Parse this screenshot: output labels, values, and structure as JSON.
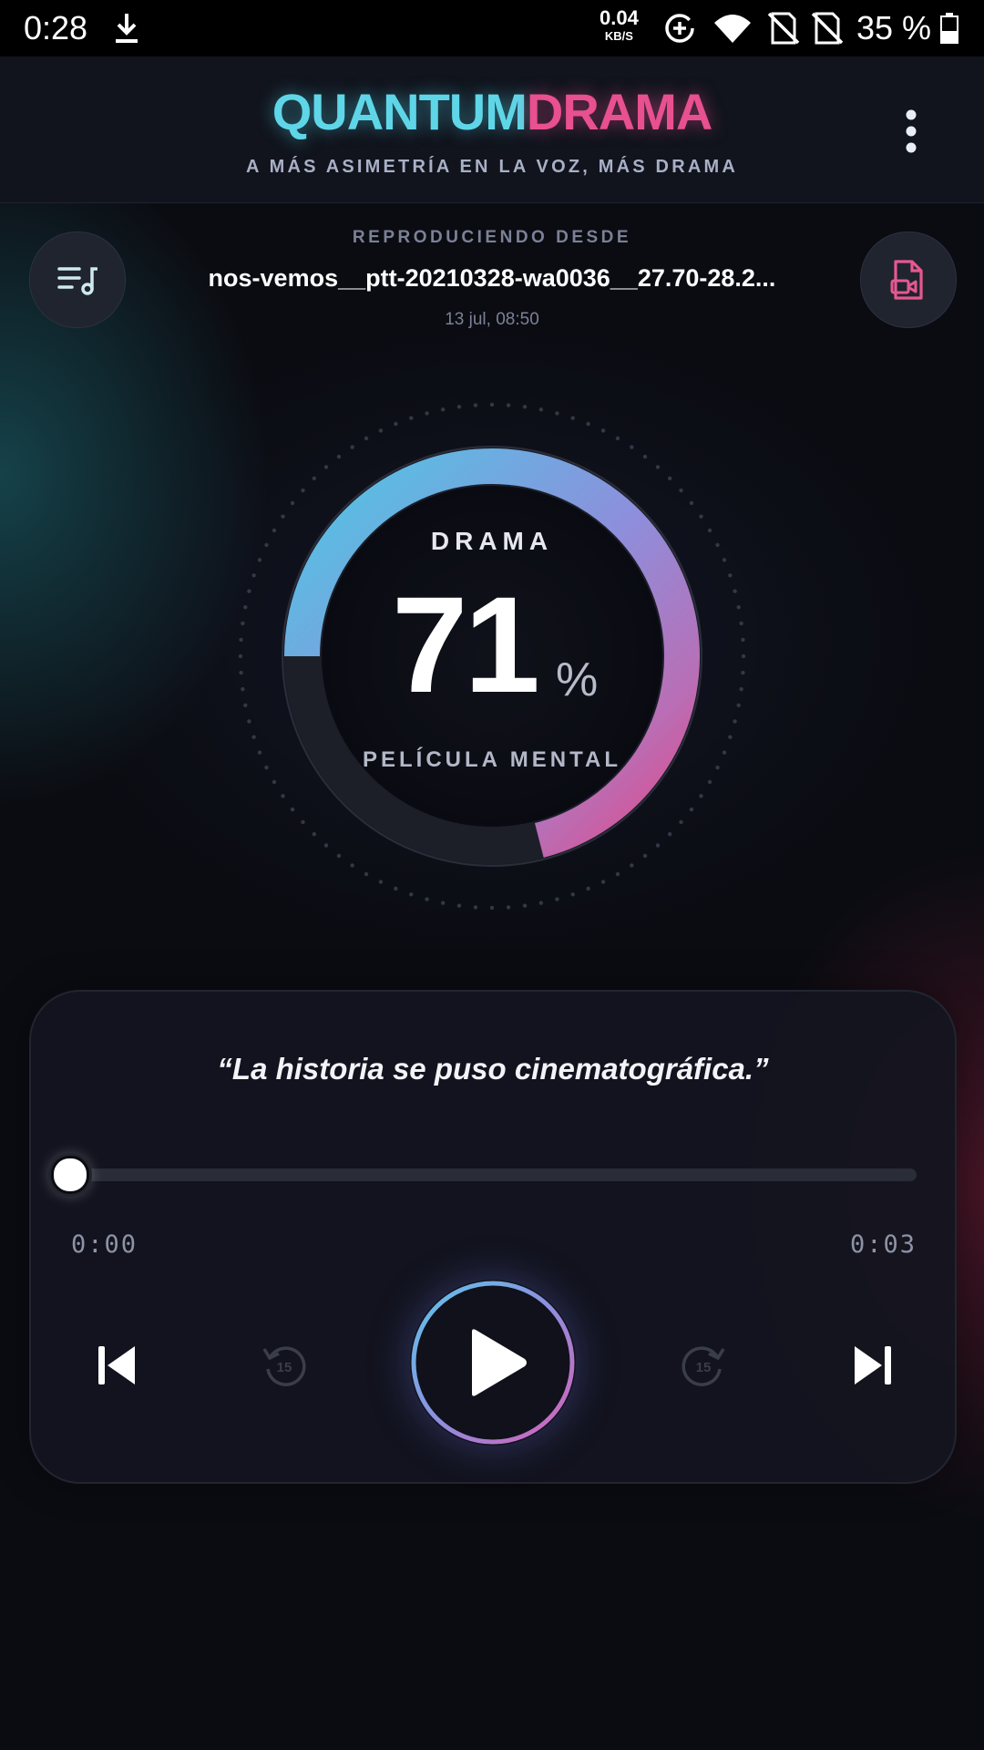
{
  "status_bar": {
    "time": "0:28",
    "net_speed_value": "0.04",
    "net_speed_unit": "KB/S",
    "battery_text": "35 %"
  },
  "header": {
    "logo_part1": "QUANTUM",
    "logo_part2": "DRAMA",
    "tagline": "A MÁS ASIMETRÍA EN LA VOZ, MÁS DRAMA"
  },
  "now_playing": {
    "label": "REPRODUCIENDO DESDE",
    "file_name": "nos-vemos__ptt-20210328-wa0036__27.70-28.2...",
    "date": "13 jul, 08:50"
  },
  "gauge": {
    "title": "DRAMA",
    "value": "71",
    "unit": "%",
    "subtitle": "PELÍCULA MENTAL",
    "fraction": 0.71
  },
  "player": {
    "quote": "“La historia se puso cinematográfica.”",
    "current_time": "0:00",
    "duration": "0:03",
    "progress": 0,
    "skip_back_seconds": "15",
    "skip_forward_seconds": "15"
  },
  "colors": {
    "accent_cyan": "#5fd6e8",
    "accent_pink": "#e8508f",
    "background": "#0b0c12"
  },
  "icons": [
    "download-icon",
    "data-saver-icon",
    "wifi-icon",
    "no-sim-icon",
    "battery-icon",
    "more-vert-icon",
    "queue-music-icon",
    "video-file-icon",
    "skip-previous-icon",
    "replay-15-icon",
    "play-icon",
    "forward-15-icon",
    "skip-next-icon"
  ]
}
